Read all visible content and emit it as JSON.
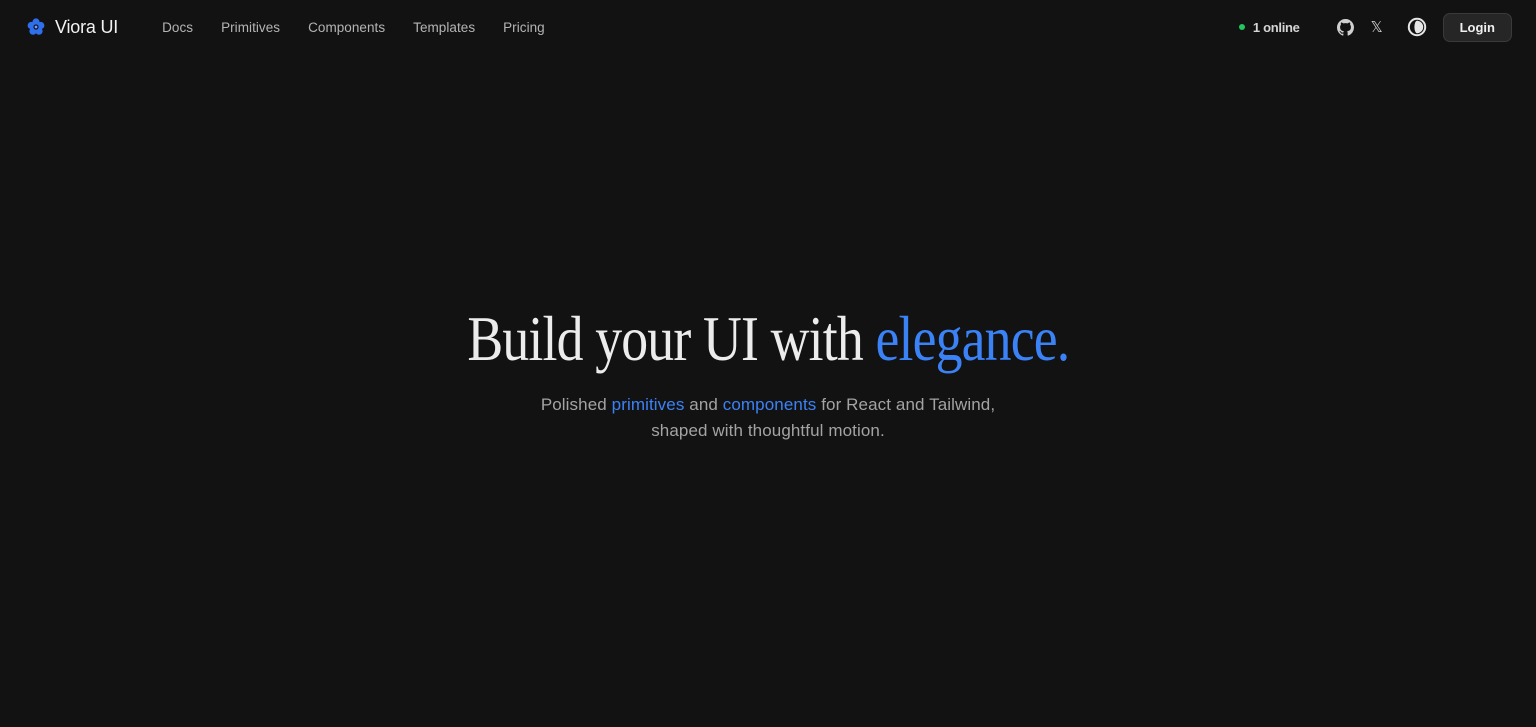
{
  "brand": {
    "name": "Viora UI",
    "logo_icon": "flower-icon",
    "logo_color": "#2f6fed"
  },
  "nav": {
    "items": [
      {
        "label": "Docs"
      },
      {
        "label": "Primitives"
      },
      {
        "label": "Components"
      },
      {
        "label": "Templates"
      },
      {
        "label": "Pricing"
      }
    ]
  },
  "header_right": {
    "online_text": "1 online",
    "online_color": "#22c55e",
    "github_icon": "github-icon",
    "x_icon": "x-icon",
    "x_glyph": "𝕏",
    "theme_icon": "theme-toggle-icon",
    "login_label": "Login"
  },
  "hero": {
    "title_main": "Build your UI with ",
    "title_accent": "elegance.",
    "subtitle_prefix": "Polished ",
    "subtitle_link1": "primitives",
    "subtitle_mid": " and ",
    "subtitle_link2": "components",
    "subtitle_suffix": " for React and Tailwind,",
    "subtitle_line2": "shaped with thoughtful motion."
  },
  "colors": {
    "background": "#121212",
    "accent": "#3b82f6"
  }
}
